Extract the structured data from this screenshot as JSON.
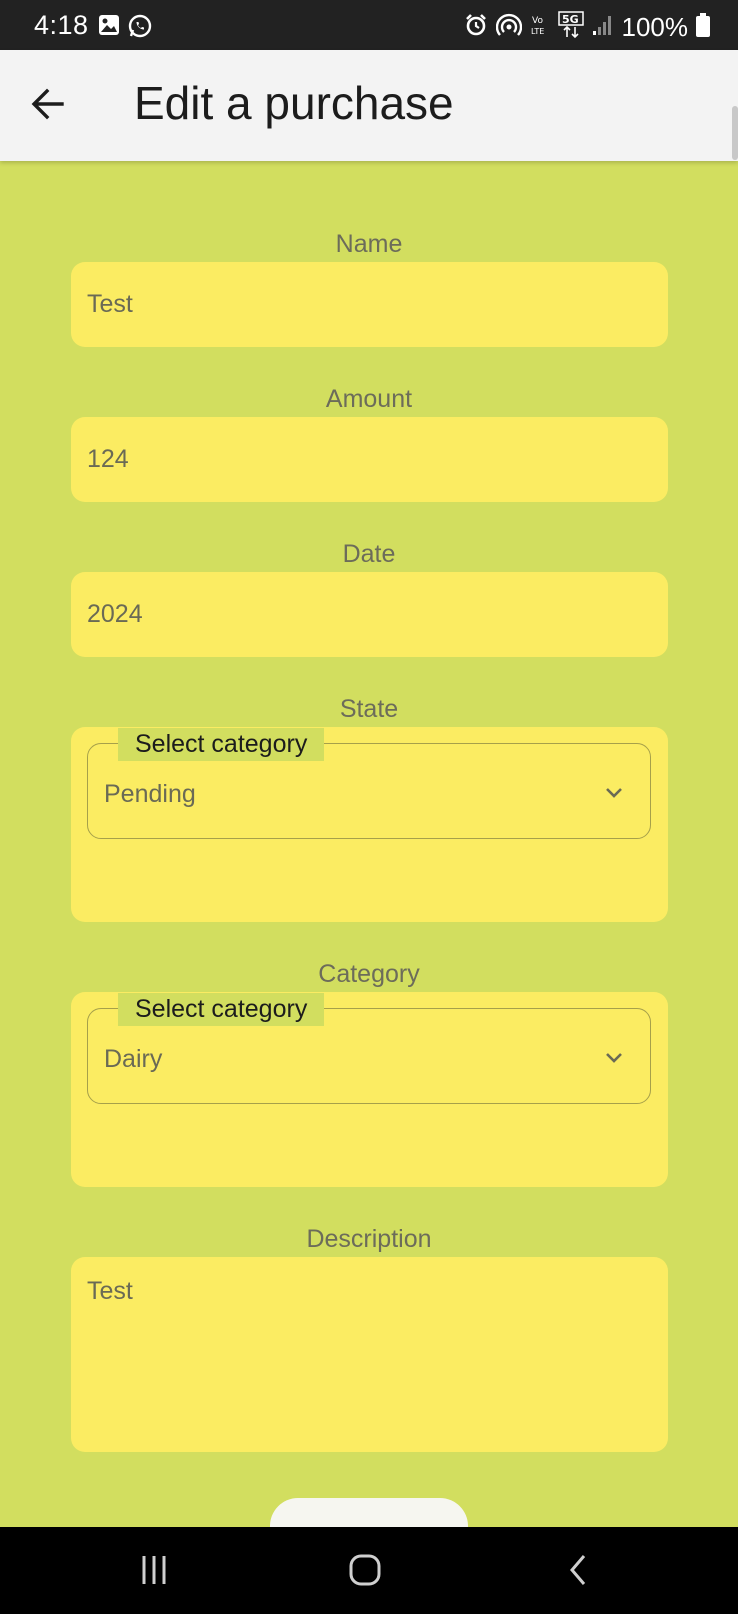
{
  "status_bar": {
    "time": "4:18",
    "battery_percent": "100%",
    "icons": [
      "image-icon",
      "whatsapp-icon",
      "alarm-icon",
      "hotspot-icon",
      "volte-icon",
      "5g-icon",
      "signal-icon",
      "battery-icon"
    ]
  },
  "app_bar": {
    "title": "Edit a purchase",
    "back_icon": "arrow-left-icon"
  },
  "form": {
    "name": {
      "label": "Name",
      "value": "Test"
    },
    "amount": {
      "label": "Amount",
      "value": "124"
    },
    "date": {
      "label": "Date",
      "value": "2024"
    },
    "state": {
      "label": "State",
      "dropdown_label": "Select category",
      "value": "Pending"
    },
    "category": {
      "label": "Category",
      "dropdown_label": "Select category",
      "value": "Dairy"
    },
    "description": {
      "label": "Description",
      "value": "Test"
    }
  },
  "colors": {
    "background": "#d2de5f",
    "field": "#fbec62",
    "app_bar": "#f3f3f3"
  },
  "nav_bar": {
    "icons": [
      "recent-apps-icon",
      "home-icon",
      "back-icon"
    ]
  }
}
